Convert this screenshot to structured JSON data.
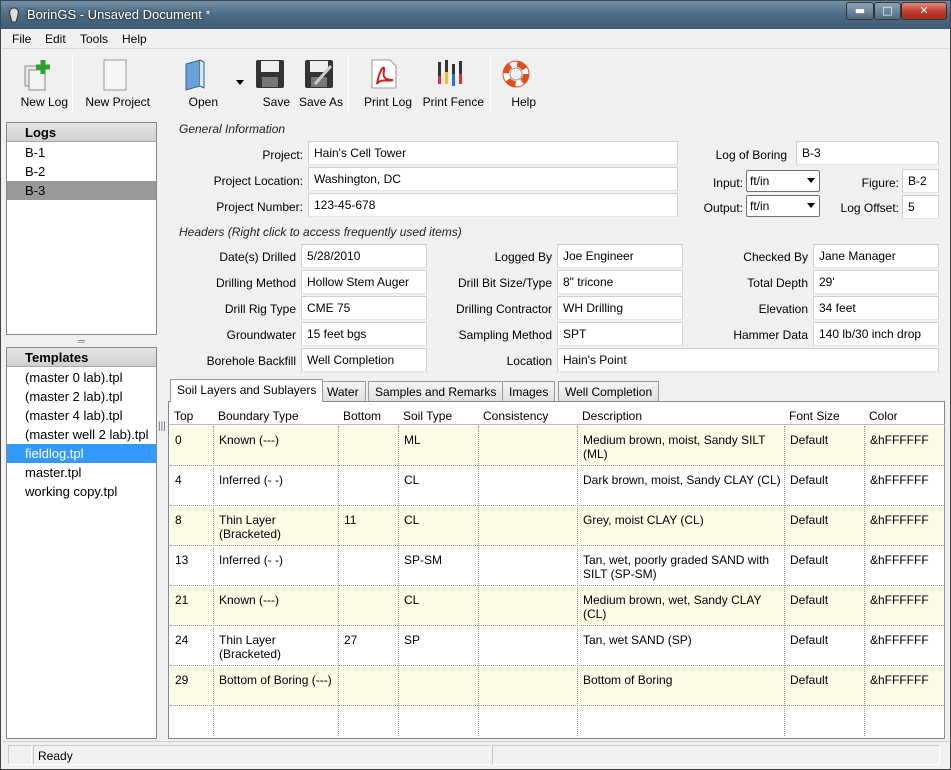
{
  "window": {
    "title": "BorinGS - Unsaved Document *",
    "min": "▬",
    "max": "□",
    "close": "✕"
  },
  "menu": [
    "File",
    "Edit",
    "Tools",
    "Help"
  ],
  "toolbar": {
    "new_log": "New Log",
    "new_project": "New Project",
    "open": "Open",
    "save": "Save",
    "save_as": "Save As",
    "print_log": "Print Log",
    "print_fence": "Print Fence",
    "help": "Help"
  },
  "logs": {
    "header": "Logs",
    "items": [
      "B-1",
      "B-2",
      "B-3"
    ],
    "selected": "B-3"
  },
  "templates": {
    "header": "Templates",
    "items": [
      "(master 0 lab).tpl",
      "(master 2 lab).tpl",
      "(master 4 lab).tpl",
      "(master well 2 lab).tpl",
      "fieldlog.tpl",
      "master.tpl",
      "working copy.tpl"
    ],
    "selected": "fieldlog.tpl"
  },
  "general": {
    "title": "General Information",
    "project_label": "Project:",
    "project": "Hain's Cell Tower",
    "location_label": "Project Location:",
    "location": "Washington, DC",
    "number_label": "Project Number:",
    "number": "123-45-678",
    "boring_label": "Log of Boring",
    "boring": "B-3",
    "input_label": "Input:",
    "input": "ft/in",
    "output_label": "Output:",
    "output": "ft/in",
    "figure_label": "Figure:",
    "figure": "B-2",
    "offset_label": "Log Offset:",
    "offset": "5"
  },
  "headers": {
    "title": "Headers (Right click to access frequently used items)",
    "date_label": "Date(s) Drilled",
    "date": "5/28/2010",
    "method_label": "Drilling Method",
    "method": "Hollow Stem Auger",
    "rig_label": "Drill Rig Type",
    "rig": "CME 75",
    "gw_label": "Groundwater",
    "gw": "15 feet bgs",
    "backfill_label": "Borehole Backfill",
    "backfill": "Well Completion",
    "logged_label": "Logged By",
    "logged": "Joe Engineer",
    "bit_label": "Drill Bit Size/Type",
    "bit": "8\" tricone",
    "contractor_label": "Drilling Contractor",
    "contractor": "WH Drilling",
    "sampling_label": "Sampling Method",
    "sampling": "SPT",
    "location_label": "Location",
    "location": "Hain's Point",
    "checked_label": "Checked By",
    "checked": "Jane Manager",
    "depth_label": "Total Depth",
    "depth": "29'",
    "elev_label": "Elevation",
    "elev": "34 feet",
    "hammer_label": "Hammer Data",
    "hammer": "140 lb/30 inch drop"
  },
  "tabs": [
    "Soil Layers and Sublayers",
    "Water",
    "Samples and Remarks",
    "Images",
    "Well Completion"
  ],
  "grid": {
    "columns": [
      "Top",
      "Boundary Type",
      "Bottom",
      "Soil Type",
      "Consistency",
      "Description",
      "Font Size",
      "Color"
    ],
    "rows": [
      [
        "0",
        "Known (---)",
        "",
        "ML",
        "",
        "Medium brown, moist, Sandy SILT (ML)",
        "Default",
        "&hFFFFFF"
      ],
      [
        "4",
        "Inferred (- -)",
        "",
        "CL",
        "",
        "Dark brown, moist, Sandy CLAY (CL)",
        "Default",
        "&hFFFFFF"
      ],
      [
        "8",
        "Thin Layer (Bracketed)",
        "11",
        "CL",
        "",
        "Grey, moist CLAY (CL)",
        "Default",
        "&hFFFFFF"
      ],
      [
        "13",
        "Inferred (- -)",
        "",
        "SP-SM",
        "",
        "Tan, wet, poorly graded SAND with SILT (SP-SM)",
        "Default",
        "&hFFFFFF"
      ],
      [
        "21",
        "Known (---)",
        "",
        "CL",
        "",
        "Medium brown, wet, Sandy CLAY (CL)",
        "Default",
        "&hFFFFFF"
      ],
      [
        "24",
        "Thin Layer (Bracketed)",
        "27",
        "SP",
        "",
        "Tan, wet SAND (SP)",
        "Default",
        "&hFFFFFF"
      ],
      [
        "29",
        "Bottom of Boring (---)",
        "",
        "",
        "",
        "Bottom of Boring",
        "Default",
        "&hFFFFFF"
      ]
    ]
  },
  "status": {
    "text": "Ready"
  }
}
